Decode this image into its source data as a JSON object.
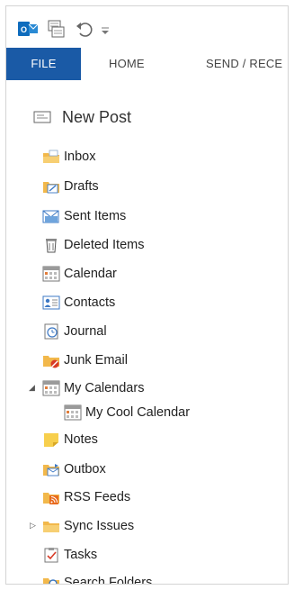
{
  "ribbon": {
    "tabs": [
      {
        "label": "FILE"
      },
      {
        "label": "HOME"
      },
      {
        "label": "SEND / RECE"
      }
    ]
  },
  "new_post": {
    "label": "New Post"
  },
  "folders": [
    {
      "label": "Inbox",
      "icon": "inbox-icon"
    },
    {
      "label": "Drafts",
      "icon": "drafts-icon"
    },
    {
      "label": "Sent Items",
      "icon": "sent-items-icon"
    },
    {
      "label": "Deleted Items",
      "icon": "trash-icon"
    },
    {
      "label": "Calendar",
      "icon": "calendar-icon"
    },
    {
      "label": "Contacts",
      "icon": "contacts-icon"
    },
    {
      "label": "Journal",
      "icon": "journal-icon"
    },
    {
      "label": "Junk Email",
      "icon": "junk-email-icon"
    },
    {
      "label": "My Calendars",
      "icon": "calendar-icon",
      "expanded": true
    },
    {
      "label": "My Cool Calendar",
      "icon": "calendar-icon"
    },
    {
      "label": "Notes",
      "icon": "notes-icon"
    },
    {
      "label": "Outbox",
      "icon": "outbox-icon"
    },
    {
      "label": "RSS Feeds",
      "icon": "rss-icon"
    },
    {
      "label": "Sync Issues",
      "icon": "folder-icon",
      "expanded": false
    },
    {
      "label": "Tasks",
      "icon": "tasks-icon"
    },
    {
      "label": "Search Folders",
      "icon": "search-folder-icon"
    }
  ],
  "colors": {
    "file_tab": "#1a5aa6",
    "folder_yellow": "#f2b84b",
    "outlook_blue": "#0f6cbd"
  }
}
